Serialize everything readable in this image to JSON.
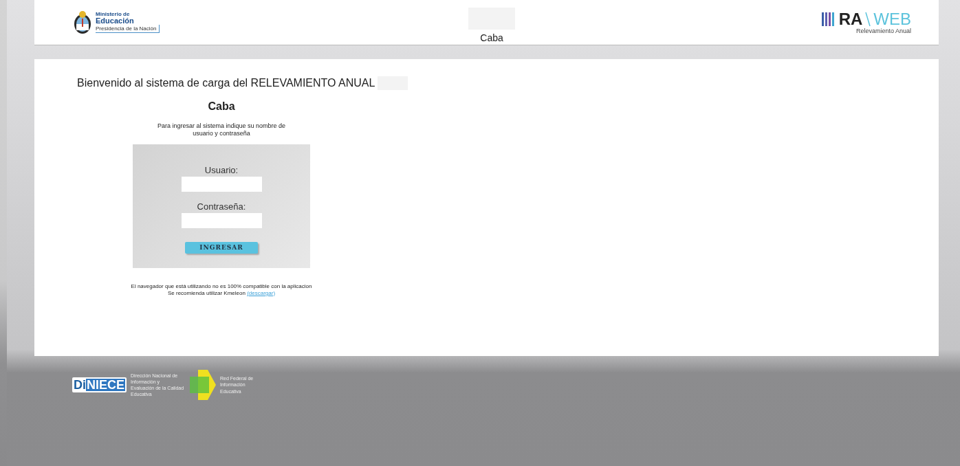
{
  "header": {
    "ministry": {
      "line_1": "Ministerio de",
      "line_2": "Educación",
      "line_3": "Presidencia de la Nación"
    },
    "title": "Caba",
    "brand": {
      "mark": "RA",
      "word": "WEB",
      "subtitle": "Relevamiento Anual"
    }
  },
  "main": {
    "welcome": "Bienvenido al sistema de carga del RELEVAMIENTO ANUAL",
    "jurisdiction": "Caba",
    "instructions": "Para ingresar al sistema indique su nombre de usuario y contraseña",
    "login": {
      "user_label": "Usuario:",
      "password_label": "Contraseña:",
      "submit": "INGRESAR"
    },
    "notice": {
      "line_1": "El navegador que está utilizando no es 100% compatible con la aplicacion",
      "line_2": "Se recomienda utilizar Kmeleon",
      "link": "(descargar)"
    }
  },
  "footer": {
    "diniece": {
      "mark_a": "Di",
      "mark_b": "NIECE",
      "caption": "Dirección Nacional de Información y Evaluación de la Calidad Educativa"
    },
    "red_federal": {
      "caption": "Red Federal de Información Educativa"
    }
  }
}
